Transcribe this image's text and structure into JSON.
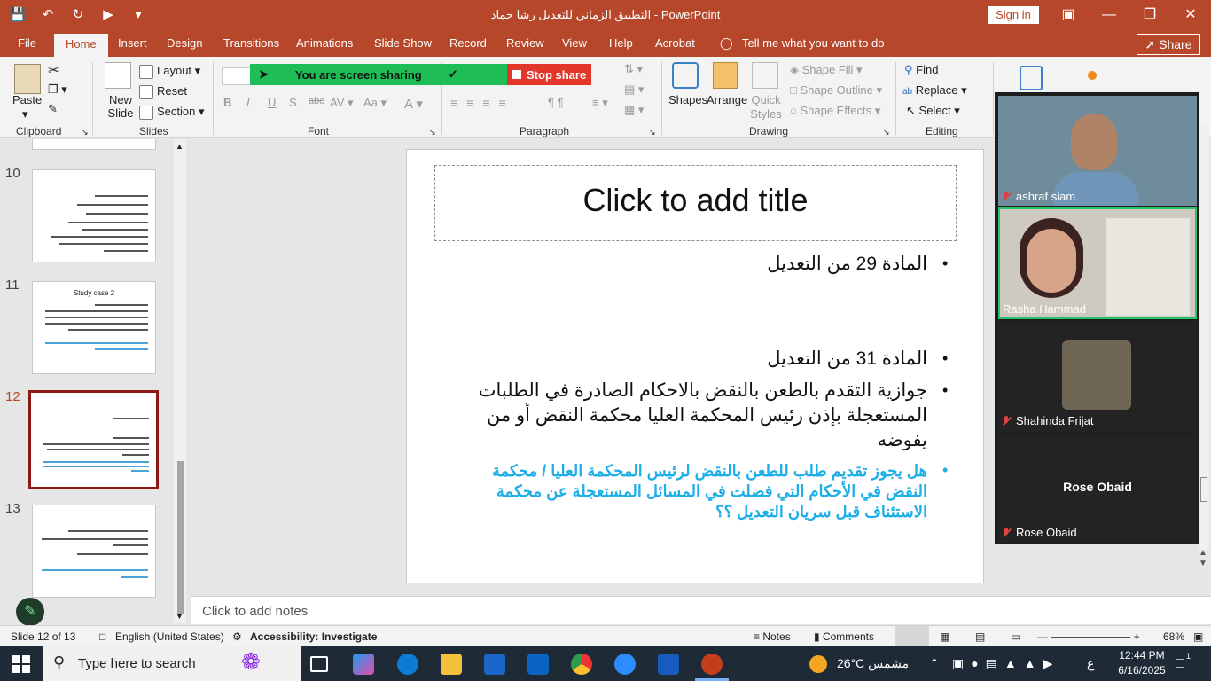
{
  "window": {
    "title": "التطبيق الزماني للتعديل رشا حماد  -  PowerPoint",
    "sign_in": "Sign in"
  },
  "tabs": [
    "File",
    "Home",
    "Insert",
    "Design",
    "Transitions",
    "Animations",
    "Slide Show",
    "Record",
    "Review",
    "View",
    "Help",
    "Acrobat"
  ],
  "tell_me": "Tell me what you want to do",
  "share_label": "Share",
  "ribbon": {
    "clipboard": {
      "paste": "Paste",
      "label": "Clipboard"
    },
    "slides": {
      "new_slide": "New Slide",
      "layout": "Layout",
      "reset": "Reset",
      "section": "Section",
      "label": "Slides"
    },
    "font": {
      "label": "Font"
    },
    "paragraph": {
      "label": "Paragraph"
    },
    "drawing": {
      "shapes": "Shapes",
      "arrange": "Arrange",
      "quick_styles": "Quick Styles",
      "shape_fill": "Shape Fill",
      "shape_outline": "Shape Outline",
      "shape_effects": "Shape Effects",
      "label": "Drawing"
    },
    "editing": {
      "find": "Find",
      "replace": "Replace",
      "select": "Select",
      "label": "Editing"
    }
  },
  "screen_share": {
    "status": "You are screen sharing",
    "stop": "Stop share"
  },
  "thumbnails": [
    {
      "num": "10",
      "title": ""
    },
    {
      "num": "11",
      "title": "Study case 2"
    },
    {
      "num": "12",
      "title": ""
    },
    {
      "num": "13",
      "title": ""
    }
  ],
  "slide": {
    "title_placeholder": "Click to add title",
    "bullets": [
      "المادة 29 من التعديل",
      "المادة 31 من التعديل",
      "جوازية التقدم بالطعن بالنقض بالاحكام الصادرة في الطلبات المستعجلة بإذن رئيس المحكمة العليا محكمة النقض أو من يفوضه"
    ],
    "question": "هل يجوز تقديم طلب للطعن بالنقض لرئيس المحكمة العليا / محكمة النقض في الأحكام التي فصلت في المسائل المستعجلة عن محكمة الاستئناف قبل سريان التعديل ؟؟"
  },
  "notes_placeholder": "Click to add notes",
  "status": {
    "slide": "Slide 12 of 13",
    "language": "English (United States)",
    "accessibility": "Accessibility: Investigate",
    "notes": "Notes",
    "comments": "Comments",
    "zoom": "68%"
  },
  "participants": [
    {
      "name": "ashraf siam"
    },
    {
      "name": "Rasha Hammad"
    },
    {
      "name": "Shahinda Frijat"
    },
    {
      "name": "Rose Obaid",
      "display": "Rose Obaid"
    }
  ],
  "taskbar": {
    "search": "Type here to search",
    "weather": "26°C  مشمس",
    "lang": "ع",
    "time": "12:44 PM",
    "date": "6/16/2025",
    "notif": "1"
  },
  "colors": {
    "brand": "#b7472a",
    "share_green": "#1ebd56",
    "stop_red": "#e3362b",
    "question_blue": "#1eaee8"
  }
}
